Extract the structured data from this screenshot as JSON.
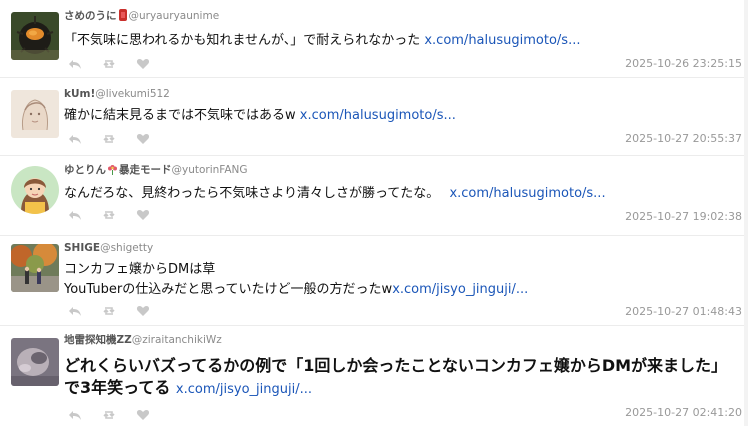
{
  "tweets": [
    {
      "name": "さめのうに",
      "name_emoji": "bow",
      "handle": "@uryauryaunime",
      "text": "「不気味に思われるかも知れませんが、」で耐えられなかった",
      "link": "x.com/halusugimoto/s...",
      "timestamp": "2025-10-26 23:25:15",
      "avatar_icon": "sea-urchin-avatar-icon"
    },
    {
      "name": "kUm!",
      "handle": "@livekumi512",
      "text": "確かに結末見るまでは不気味ではあるw",
      "link": "x.com/halusugimoto/s...",
      "timestamp": "2025-10-27 20:55:37",
      "avatar_icon": "sketch-avatar-icon"
    },
    {
      "name": "ゆとりん",
      "name_suffix": "暴走モード",
      "handle": "@yutorinFANG",
      "text": "なんだろな、見終わったら不気味さより清々しさが勝ってたな。",
      "link": "x.com/halusugimoto/s...",
      "timestamp": "2025-10-27 19:02:38",
      "avatar_icon": "cartoon-woman-avatar-icon"
    },
    {
      "name": "SHIGE",
      "handle": "@shigetty",
      "line1": "コンカフェ嬢からDMは草",
      "text": "YouTuberの仕込みだと思っていたけど一般の方だったw",
      "link": "x.com/jisyo_jinguji/...",
      "timestamp": "2025-10-27 01:48:43",
      "avatar_icon": "autumn-park-avatar-icon"
    },
    {
      "name": "地雷探知機ZZ",
      "handle": "@ziraitanchikiWz",
      "text": "どれくらいバズってるかの例で「1回しか会ったことないコンカフェ嬢からDMが来ました」で3年笑ってる",
      "link": "x.com/jisyo_jinguji/...",
      "timestamp": "2025-10-27 02:41:20",
      "avatar_icon": "blurred-face-avatar-icon"
    }
  ],
  "colors": {
    "link": "#1b56b8",
    "name": "#555555",
    "handle": "#8a8a8a",
    "timestamp": "#999999",
    "action_icon": "#c8c8c8"
  }
}
